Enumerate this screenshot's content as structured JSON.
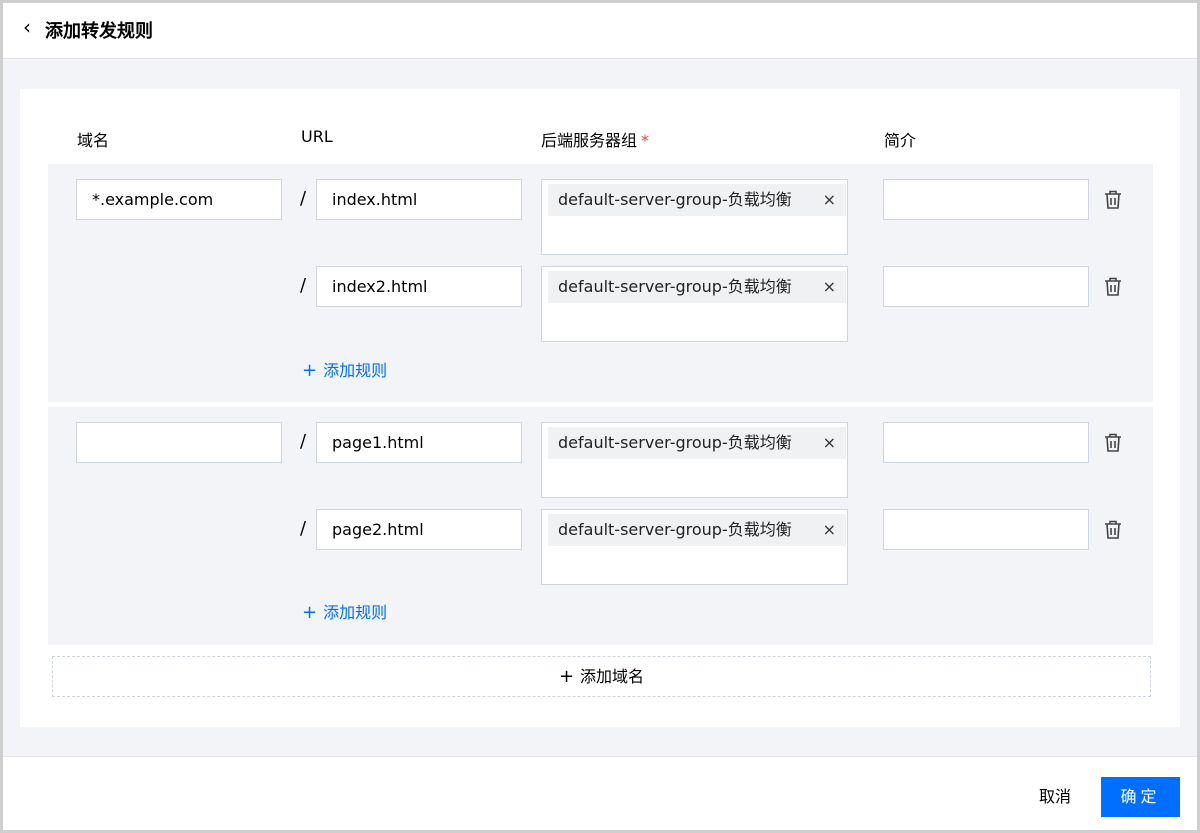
{
  "header": {
    "title": "添加转发规则",
    "back_icon": "chevron-left-icon"
  },
  "columns": {
    "domain": "域名",
    "url": "URL",
    "server_group": "后端服务器组",
    "required_mark": "*",
    "description": "简介"
  },
  "groups": [
    {
      "domain": "*.example.com",
      "rules": [
        {
          "slash": "/",
          "url": "index.html",
          "server_group": "default-server-group-负载均衡",
          "description": ""
        },
        {
          "slash": "/",
          "url": "index2.html",
          "server_group": "default-server-group-负载均衡",
          "description": ""
        }
      ],
      "add_rule": {
        "plus": "+",
        "label": "添加规则"
      }
    },
    {
      "domain": "",
      "rules": [
        {
          "slash": "/",
          "url": "page1.html",
          "server_group": "default-server-group-负载均衡",
          "description": ""
        },
        {
          "slash": "/",
          "url": "page2.html",
          "server_group": "default-server-group-负载均衡",
          "description": ""
        }
      ],
      "add_rule": {
        "plus": "+",
        "label": "添加规则"
      }
    }
  ],
  "tag_close": "×",
  "add_domain": {
    "plus": "+",
    "label": "添加域名"
  },
  "footer": {
    "cancel_label": "取消",
    "confirm_label": "确定"
  },
  "colors": {
    "accent": "#006eff",
    "required": "#e54545",
    "group_bg": "#f3f4f7",
    "border": "#cfd5de"
  },
  "icons": {
    "trash": "trash-icon",
    "back": "chevron-left-icon",
    "close": "close-icon"
  }
}
